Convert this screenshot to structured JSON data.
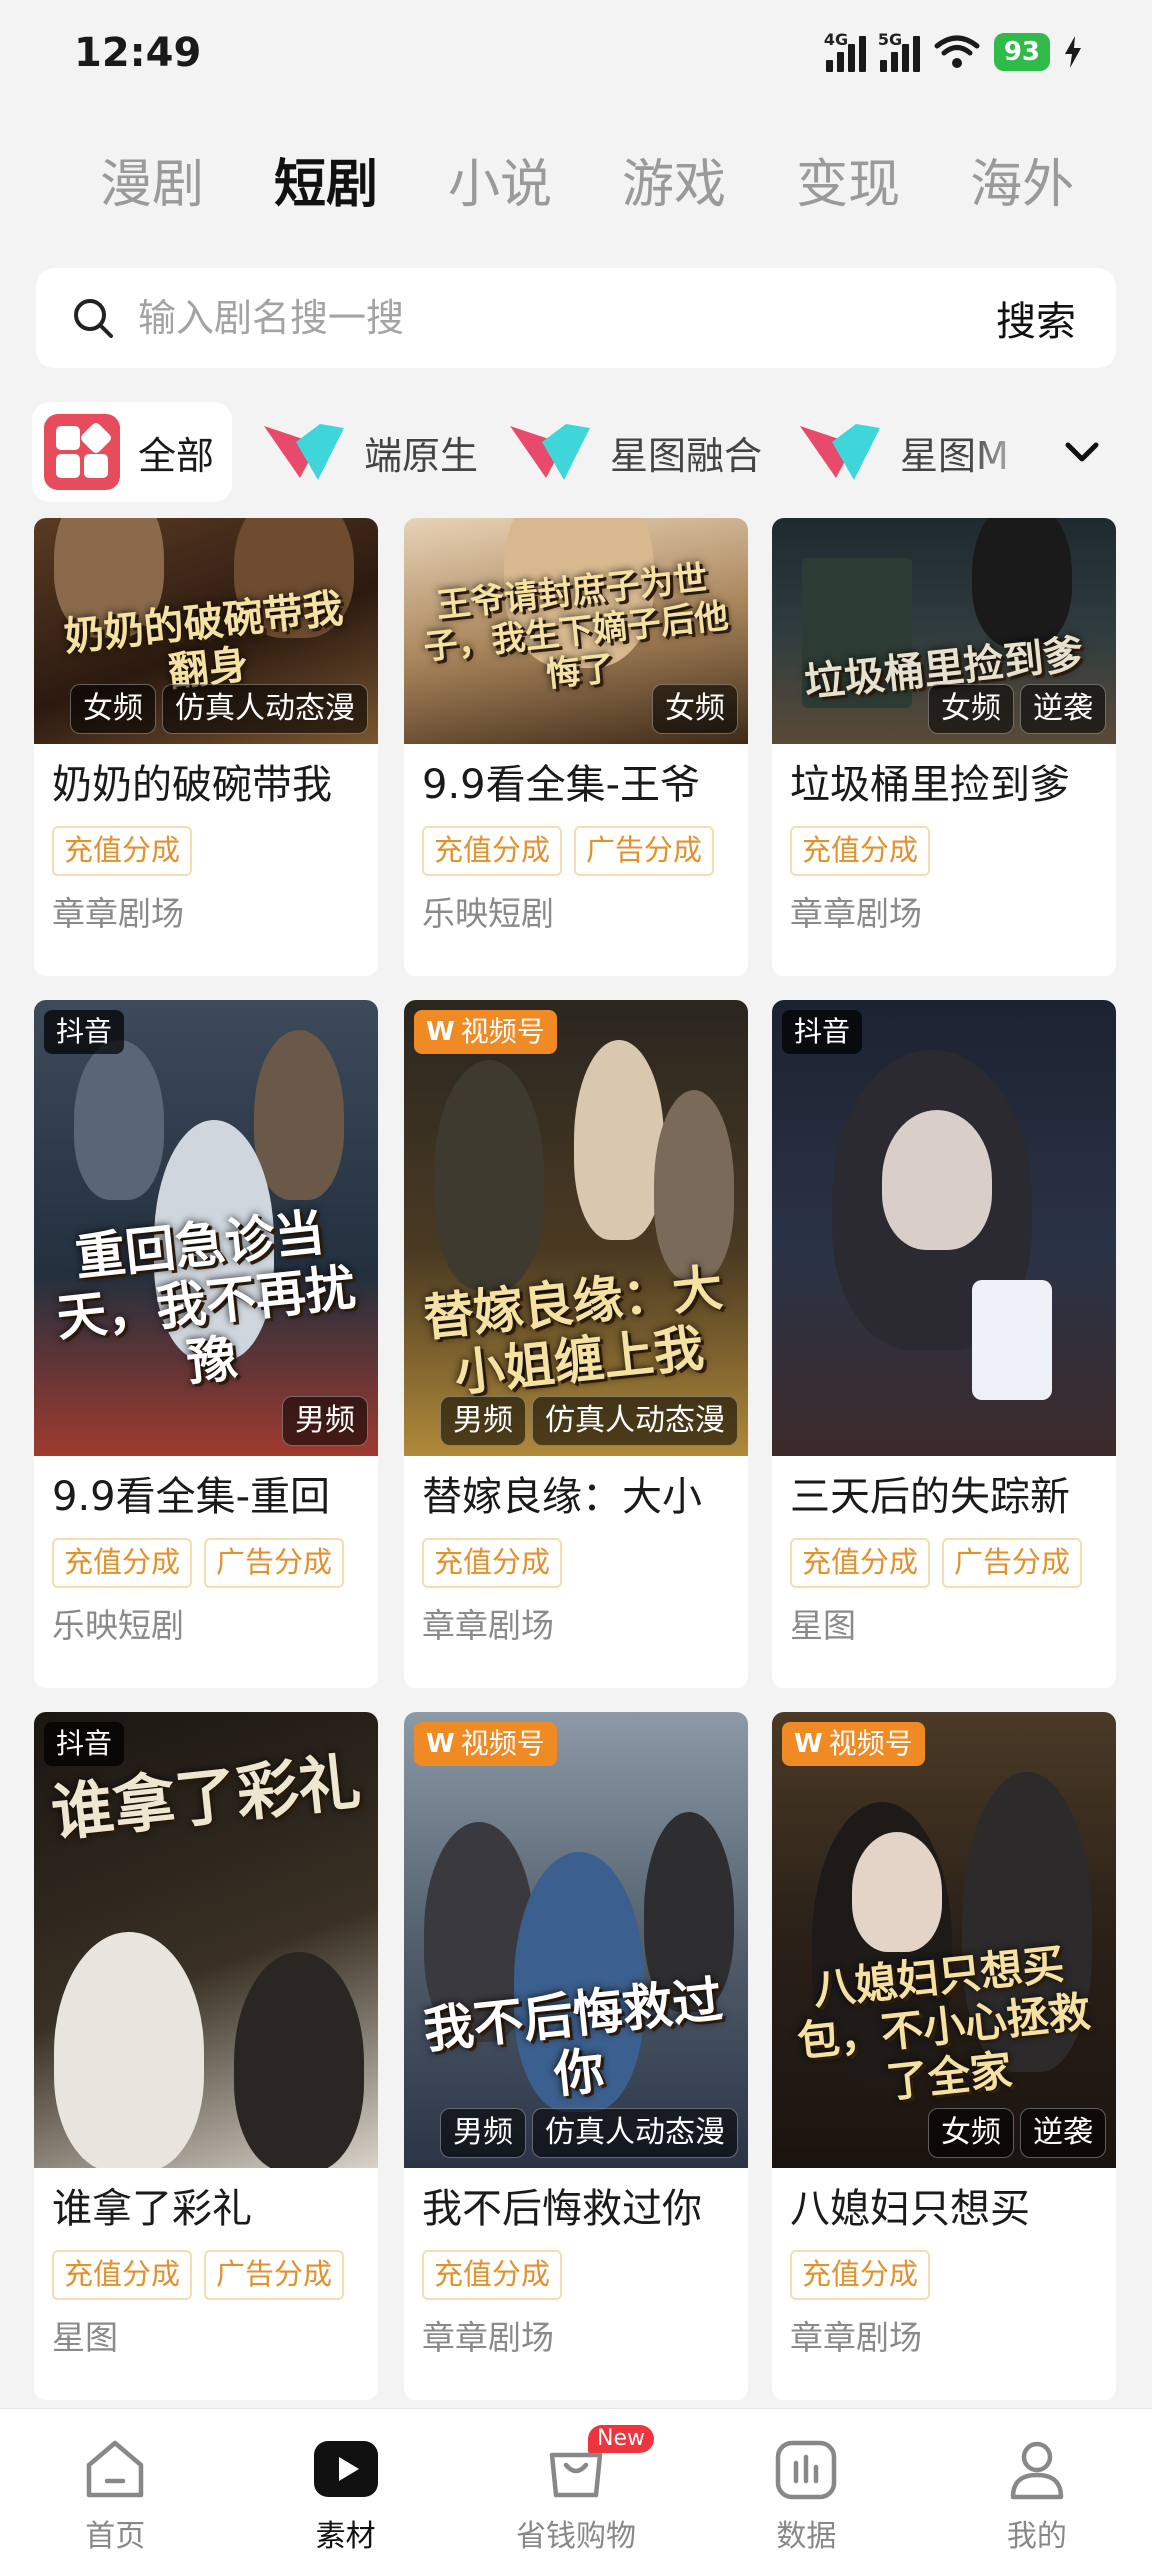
{
  "status_bar": {
    "time": "12:49",
    "net1": "4G",
    "net2": "5G",
    "battery": "93"
  },
  "top_tabs": [
    {
      "label": "漫剧",
      "active": false
    },
    {
      "label": "短剧",
      "active": true
    },
    {
      "label": "小说",
      "active": false
    },
    {
      "label": "游戏",
      "active": false
    },
    {
      "label": "变现",
      "active": false
    },
    {
      "label": "海外",
      "active": false
    }
  ],
  "search": {
    "placeholder": "输入剧名搜一搜",
    "button_label": "搜索"
  },
  "filters": [
    {
      "label": "全部"
    },
    {
      "label": "端原生"
    },
    {
      "label": "星图融合"
    },
    {
      "label": "星图M"
    }
  ],
  "cards": [
    {
      "title": "奶奶的破碗带我",
      "poster_text": "奶奶的破碗带我翻身",
      "platform": "",
      "poster_tags": [
        "女频",
        "仿真人动态漫"
      ],
      "share_tags": [
        "充值分成"
      ],
      "producer": "章章剧场"
    },
    {
      "title": "9.9看全集-王爷",
      "poster_text": "王爷请封庶子为世子，我生下嫡子后他悔了",
      "platform": "",
      "poster_tags": [
        "女频"
      ],
      "share_tags": [
        "充值分成",
        "广告分成"
      ],
      "producer": "乐映短剧"
    },
    {
      "title": "垃圾桶里捡到爹",
      "poster_text": "垃圾桶里捡到爹",
      "platform": "",
      "poster_tags": [
        "女频",
        "逆袭"
      ],
      "share_tags": [
        "充值分成"
      ],
      "producer": "章章剧场"
    },
    {
      "title": "9.9看全集-重回",
      "poster_text": "重回急诊当天，我不再扰豫",
      "platform": "抖音",
      "poster_tags": [
        "男频"
      ],
      "share_tags": [
        "充值分成",
        "广告分成"
      ],
      "producer": "乐映短剧"
    },
    {
      "title": "替嫁良缘：大小",
      "poster_text": "替嫁良缘：大小姐缠上我",
      "platform": "视频号",
      "poster_tags": [
        "男频",
        "仿真人动态漫"
      ],
      "share_tags": [
        "充值分成"
      ],
      "producer": "章章剧场"
    },
    {
      "title": "三天后的失踪新",
      "poster_text": "",
      "platform": "抖音",
      "poster_tags": [],
      "share_tags": [
        "充值分成",
        "广告分成"
      ],
      "producer": "星图"
    },
    {
      "title": "谁拿了彩礼",
      "poster_text": "谁拿了彩礼",
      "platform": "抖音",
      "poster_tags": [],
      "share_tags": [
        "充值分成",
        "广告分成"
      ],
      "producer": "星图"
    },
    {
      "title": "我不后悔救过你",
      "poster_text": "我不后悔救过你",
      "platform": "视频号",
      "poster_tags": [
        "男频",
        "仿真人动态漫"
      ],
      "share_tags": [
        "充值分成"
      ],
      "producer": "章章剧场"
    },
    {
      "title": "八媳妇只想买",
      "poster_text": "八媳妇只想买包，不小心拯救了全家",
      "platform": "视频号",
      "poster_tags": [
        "女频",
        "逆袭"
      ],
      "share_tags": [
        "充值分成"
      ],
      "producer": "章章剧场"
    }
  ],
  "bottom_nav": [
    {
      "label": "首页",
      "icon": "home-icon",
      "active": false
    },
    {
      "label": "素材",
      "icon": "play-icon",
      "active": true
    },
    {
      "label": "省钱购物",
      "icon": "shopping-bag-icon",
      "active": false,
      "badge": "New"
    },
    {
      "label": "数据",
      "icon": "chart-icon",
      "active": false
    },
    {
      "label": "我的",
      "icon": "user-icon",
      "active": false
    }
  ],
  "colors": {
    "accent": "#e2912f",
    "active_nav": "#111111",
    "all_icon": "#e64c5c",
    "wechat_badge": "#f08a24",
    "new_badge": "#f0343e"
  }
}
